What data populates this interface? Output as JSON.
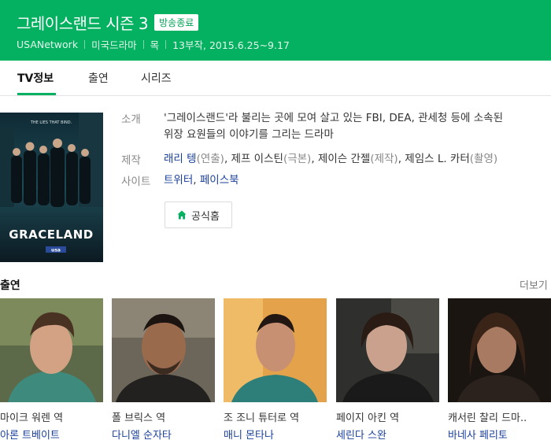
{
  "header": {
    "title": "그레이스랜드 시즌 3",
    "status_badge": "방송종료",
    "network": "USANetwork",
    "genre": "미국드라마",
    "day": "목",
    "episodes_dates": "13부작, 2015.6.25~9.17"
  },
  "tabs": [
    {
      "label": "TV정보"
    },
    {
      "label": "출연"
    },
    {
      "label": "시리즈"
    }
  ],
  "poster": {
    "tagline": "THE LIES THAT BIND.",
    "show_name": "GRACELAND",
    "network_logo": "usa"
  },
  "info": {
    "intro_label": "소개",
    "intro_line1": "'그레이스랜드'라 불리는 곳에 모여 살고 있는 FBI, DEA, 관세청 등에 소속된",
    "intro_line2": "위장 요원들의 이야기를 그리는 드라마",
    "production_label": "제작",
    "production": [
      {
        "name": "래리 텡",
        "role": "(연출)"
      },
      {
        "name": "제프 이스틴",
        "role": "(극본)"
      },
      {
        "name": "제이슨 간젤",
        "role": "(제작)"
      },
      {
        "name": "제임스 L. 카터",
        "role": "(촬영)"
      }
    ],
    "site_label": "사이트",
    "sites": [
      "트위터",
      "페이스북"
    ],
    "home_button": "공식홈",
    "home_icon": "home-icon"
  },
  "cast": {
    "title": "출연",
    "more": "더보기",
    "items": [
      {
        "role": "마이크 워렌 역",
        "name": "아론 트베이트"
      },
      {
        "role": "폴 브릭스 역",
        "name": "다니엘 순자타"
      },
      {
        "role": "조 조니 튜터로 역",
        "name": "매니 몬타나"
      },
      {
        "role": "페이지 아킨 역",
        "name": "세린다 스완"
      },
      {
        "role": "캐서린 찰리 드마..",
        "name": "바네사 페리토"
      }
    ]
  },
  "colors": {
    "brand_green": "#03b160",
    "link_blue": "#1a3f99"
  }
}
